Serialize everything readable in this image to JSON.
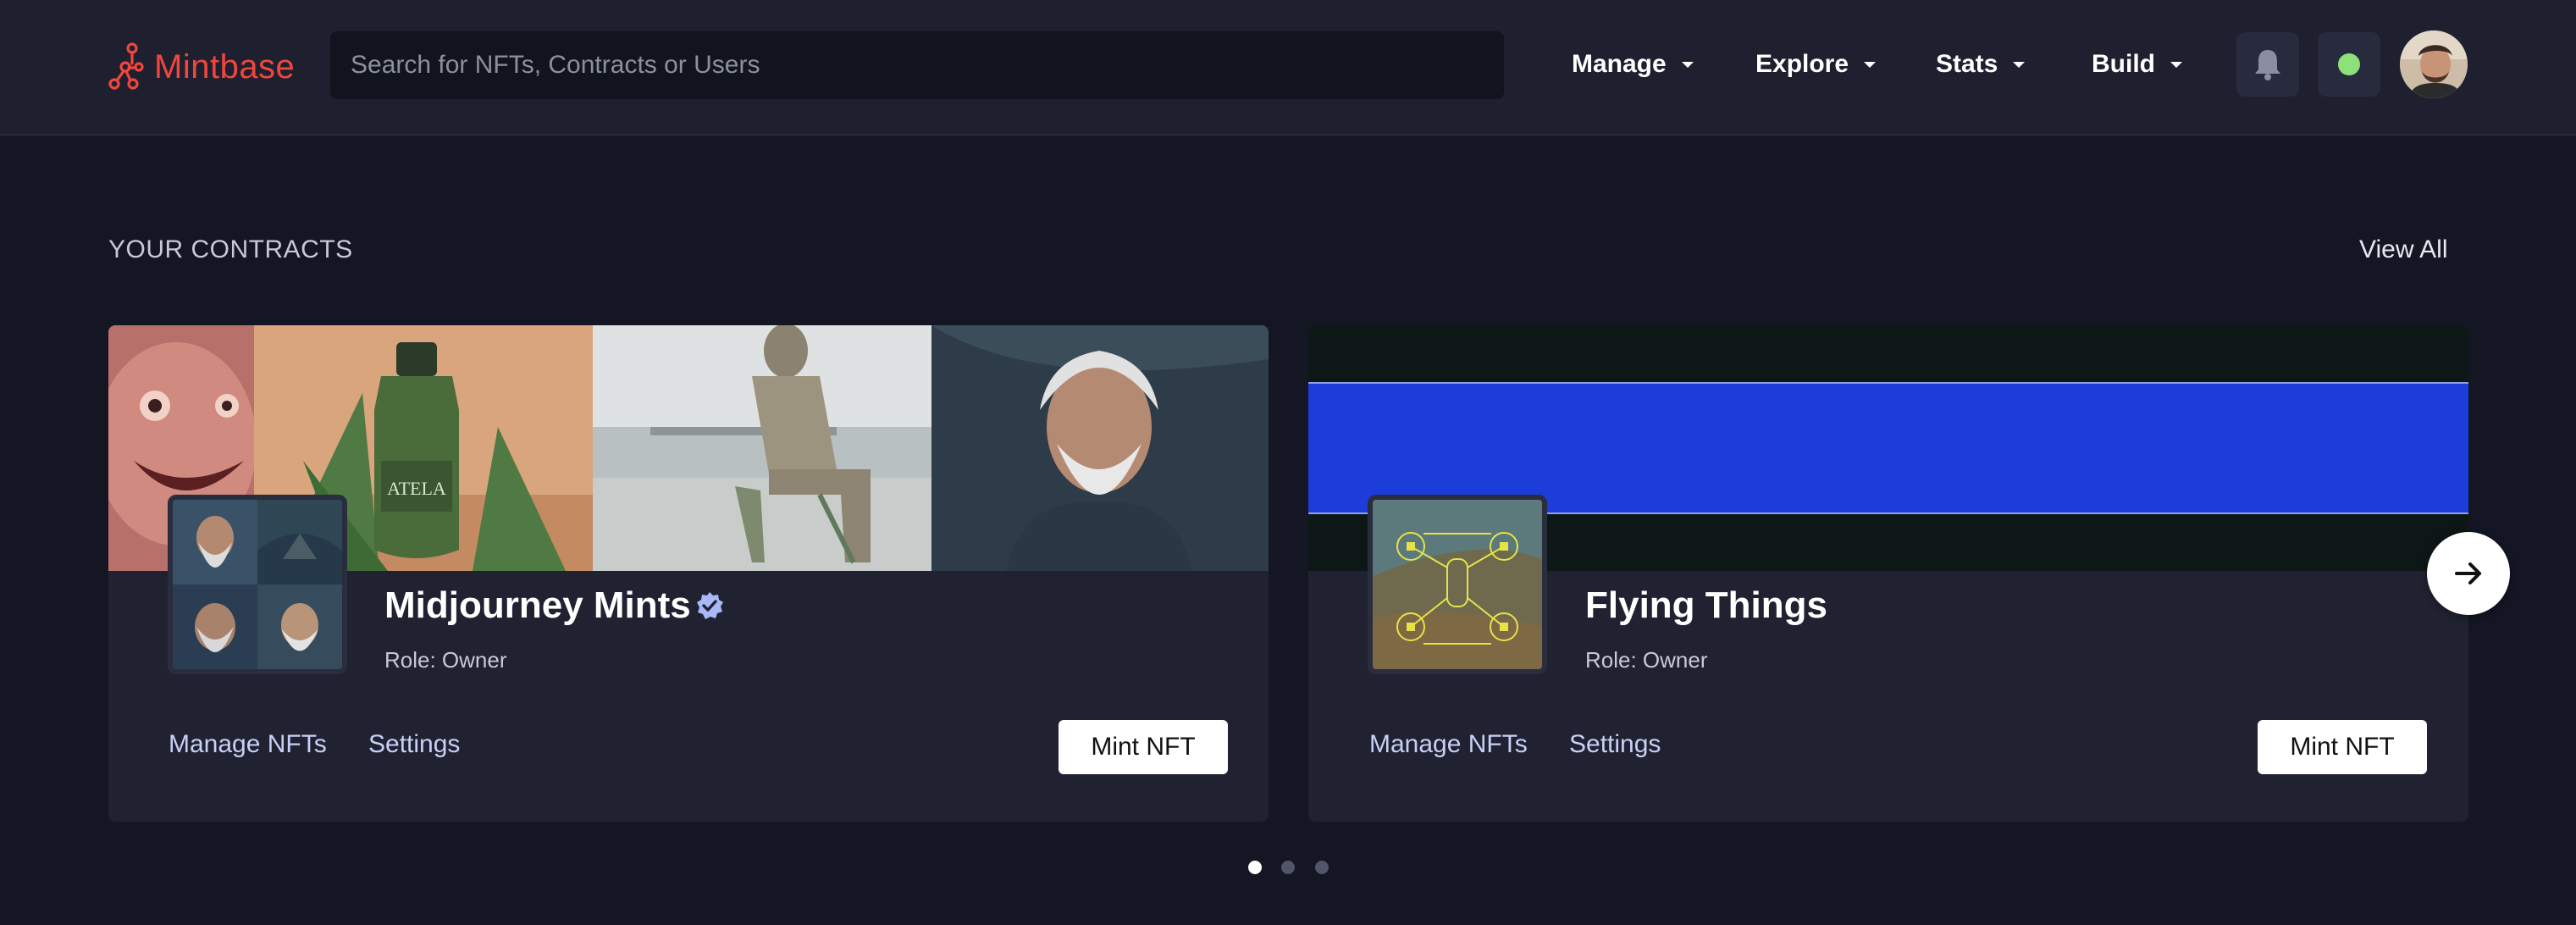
{
  "header": {
    "brand": "Mintbase",
    "search_placeholder": "Search for NFTs, Contracts or Users",
    "nav": [
      {
        "label": "Manage",
        "icon": "chevron-down-icon"
      },
      {
        "label": "Explore",
        "icon": "chevron-down-icon"
      },
      {
        "label": "Stats",
        "icon": "chevron-down-icon"
      },
      {
        "label": "Build",
        "icon": "chevron-down-icon"
      }
    ],
    "icons": {
      "notifications": "bell-icon",
      "status": "status-dot-icon",
      "profile": "avatar"
    }
  },
  "section": {
    "title": "YOUR CONTRACTS",
    "view_all": "View All"
  },
  "contracts": [
    {
      "name": "Midjourney Mints",
      "verified": true,
      "role": "Role: Owner",
      "manage_label": "Manage NFTs",
      "settings_label": "Settings",
      "mint_label": "Mint NFT"
    },
    {
      "name": "Flying Things",
      "verified": false,
      "role": "Role: Owner",
      "manage_label": "Manage NFTs",
      "settings_label": "Settings",
      "mint_label": "Mint NFT"
    }
  ],
  "carousel": {
    "pages": 3,
    "active_page": 1,
    "next_icon": "arrow-right-icon"
  },
  "colors": {
    "brand": "#f0463c",
    "background": "#141624",
    "header": "#1e2030",
    "card": "#202232",
    "accent_blue": "#1d3ddb",
    "status_online": "#8ee07a"
  }
}
